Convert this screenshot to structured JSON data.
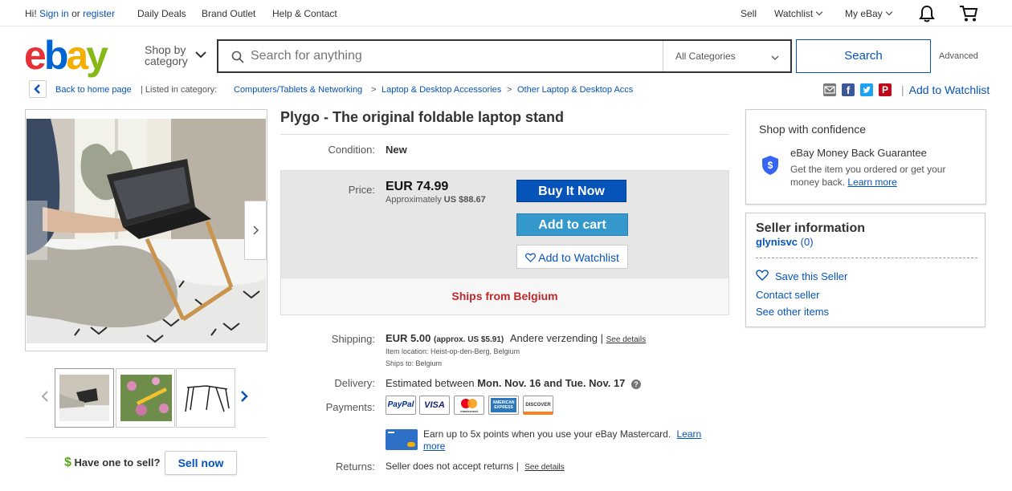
{
  "topbar": {
    "greeting": "Hi!",
    "sign_in": "Sign in",
    "or": "or",
    "register": "register",
    "daily_deals": "Daily Deals",
    "brand_outlet": "Brand Outlet",
    "help_contact": "Help & Contact",
    "sell": "Sell",
    "watchlist": "Watchlist",
    "my_ebay": "My eBay"
  },
  "header": {
    "logo_letters": [
      "e",
      "b",
      "a",
      "y"
    ],
    "logo_colors": [
      "#e53238",
      "#0064d2",
      "#f5af02",
      "#86b817"
    ],
    "shop_by_line1": "Shop by",
    "shop_by_line2": "category",
    "search_placeholder": "Search for anything",
    "category_select": "All Categories",
    "search_button": "Search",
    "advanced": "Advanced"
  },
  "breadcrumb": {
    "back": "Back to home page",
    "listed_in": "| Listed in category:",
    "items": [
      "Computers/Tablets & Networking",
      "Laptop & Desktop Accessories",
      "Other Laptop & Desktop Accs"
    ],
    "separator": ">",
    "add_to_watchlist": "Add to Watchlist"
  },
  "item": {
    "title": "Plygo - The original foldable laptop stand",
    "condition_label": "Condition:",
    "condition": "New",
    "price_label": "Price:",
    "price": "EUR 74.99",
    "approx_prefix": "Approximately",
    "approx_value": "US $88.67",
    "buy_now": "Buy It Now",
    "add_to_cart": "Add to cart",
    "add_to_watchlist": "Add to Watchlist",
    "ships_from": "Ships from Belgium",
    "shipping_label": "Shipping:",
    "shipping_price": "EUR 5.00",
    "shipping_approx": "(approx. US $5.91)",
    "shipping_method": "Andere verzending |",
    "see_details": "See details",
    "item_location": "Item location:  Heist-op-den-Berg, Belgium",
    "ships_to": "Ships to:  Belgium",
    "delivery_label": "Delivery:",
    "delivery_prefix": "Estimated between",
    "delivery_dates": "Mon. Nov. 16 and Tue. Nov. 17",
    "payments_label": "Payments:",
    "payment_logos": [
      "PayPal",
      "VISA",
      "mastercard",
      "AMERICAN EXPRESS",
      "DISCOVER"
    ],
    "mastercard_promo": "Earn up to 5x points when you use your eBay Mastercard.",
    "learn": "Learn",
    "more": "more",
    "returns_label": "Returns:",
    "returns_value": "Seller does not accept returns |",
    "returns_details": "See details"
  },
  "gallery": {
    "have_one": "Have one to sell?",
    "sell_now": "Sell now"
  },
  "confidence": {
    "heading": "Shop with confidence",
    "guarantee_title": "eBay Money Back Guarantee",
    "guarantee_text_1": "Get the item you ordered or get your",
    "guarantee_text_2": "money back.",
    "learn_more": "Learn more"
  },
  "seller": {
    "heading": "Seller information",
    "name": "glynisvc",
    "score": "(0)",
    "save": "Save this Seller",
    "contact": "Contact seller",
    "other_items": "See other items"
  }
}
